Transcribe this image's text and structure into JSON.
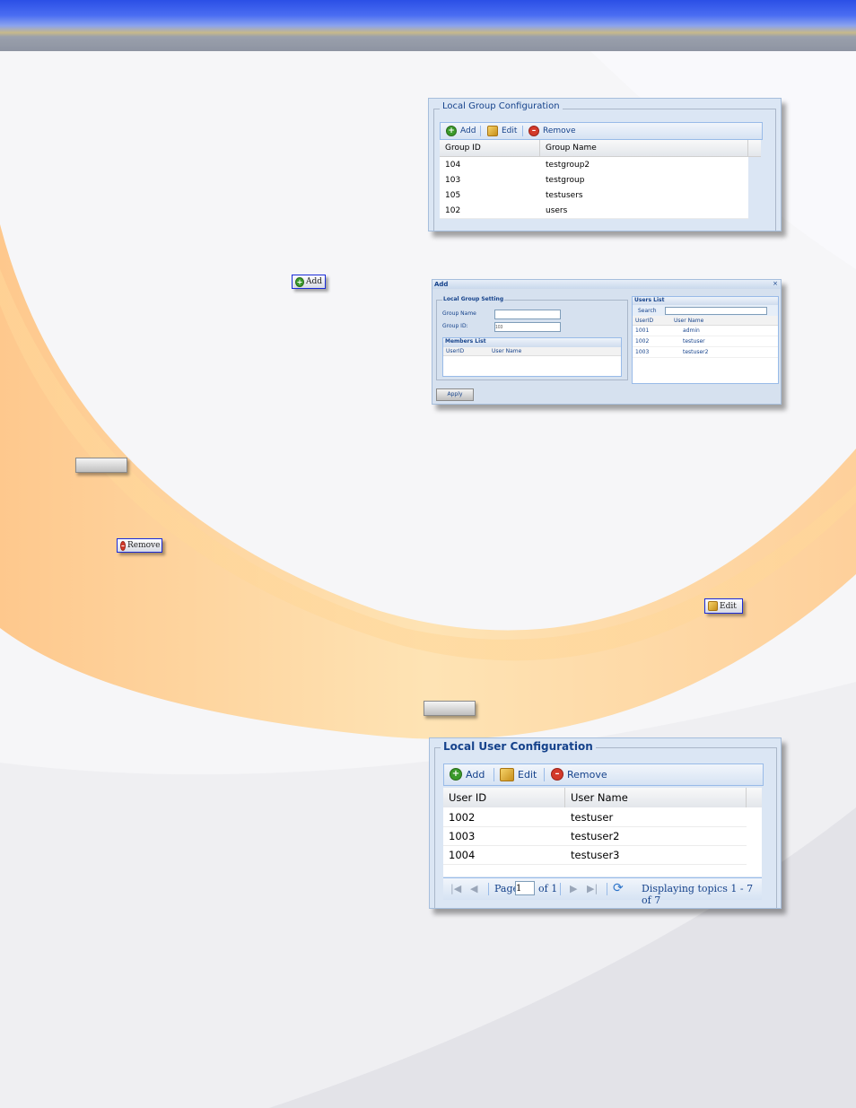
{
  "group_panel": {
    "title": "Local Group Configuration",
    "toolbar": {
      "add": "Add",
      "edit": "Edit",
      "remove": "Remove"
    },
    "columns": [
      "Group ID",
      "Group Name"
    ],
    "rows": [
      [
        "104",
        "testgroup2"
      ],
      [
        "103",
        "testgroup"
      ],
      [
        "105",
        "testusers"
      ],
      [
        "102",
        "users"
      ]
    ]
  },
  "add_dialog": {
    "title": "Add",
    "group_setting_title": "Local Group Setting",
    "group_name_label": "Group Name",
    "group_name_value": "",
    "group_id_label": "Group ID:",
    "group_id_value": "103",
    "members_title": "Members List",
    "members_columns": [
      "UserID",
      "User Name"
    ],
    "users_title": "Users List",
    "search_label": "Search",
    "users_columns": [
      "UserID",
      "User Name"
    ],
    "users_rows": [
      [
        "1001",
        "admin"
      ],
      [
        "1002",
        "testuser"
      ],
      [
        "1003",
        "testuser2"
      ]
    ],
    "apply_label": "Apply"
  },
  "chips": {
    "add": "Add",
    "remove": "Remove",
    "edit": "Edit"
  },
  "user_panel": {
    "title": "Local User Configuration",
    "toolbar": {
      "add": "Add",
      "edit": "Edit",
      "remove": "Remove"
    },
    "columns": [
      "User ID",
      "User Name"
    ],
    "rows": [
      [
        "1002",
        "testuser"
      ],
      [
        "1003",
        "testuser2"
      ],
      [
        "1004",
        "testuser3"
      ]
    ],
    "pager": {
      "page_label": "Page",
      "page_value": "1",
      "of_label": "of 1",
      "display_text": "Displaying topics 1 - 7 of 7"
    }
  },
  "colors": {
    "header_blue": "#2b4fe6",
    "panel_bg": "#dbe6f4",
    "accent_orange": "#ffb347"
  }
}
